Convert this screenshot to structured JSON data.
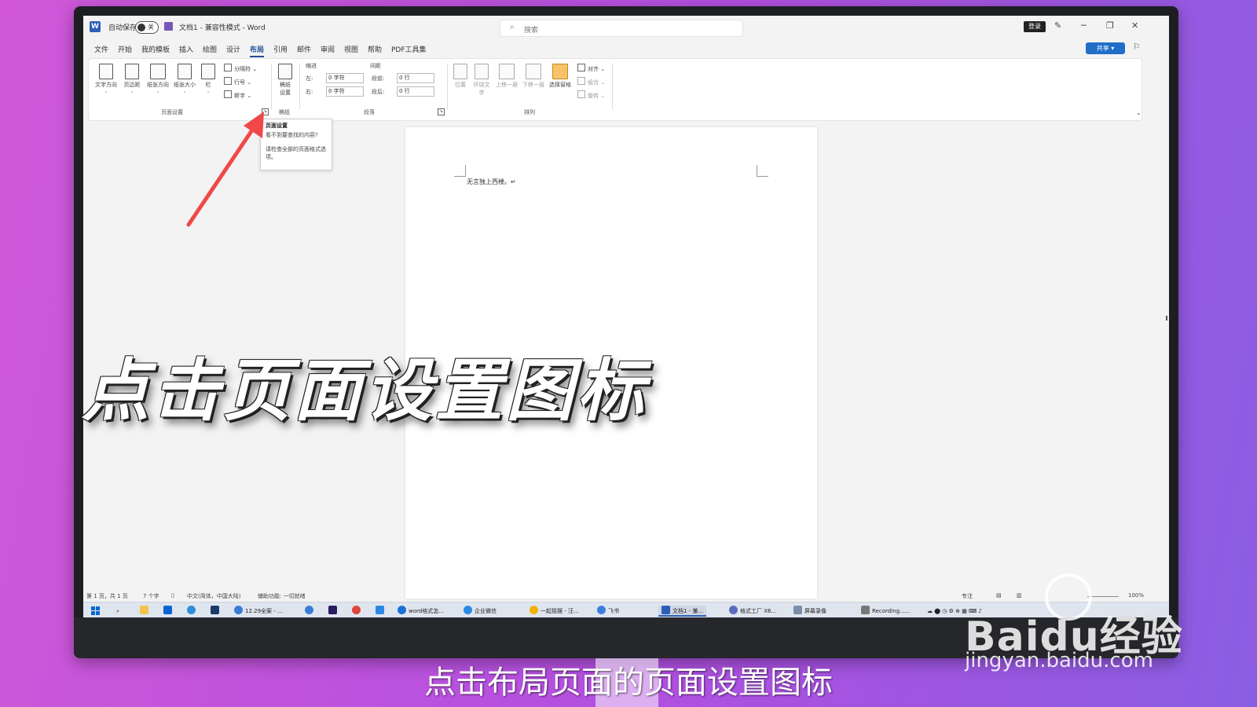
{
  "titlebar": {
    "autosave_label": "自动保存",
    "autosave_state": "关",
    "doc_title": "文档1 - 兼容性模式 - Word",
    "search_placeholder": "搜索",
    "login_label": "登录"
  },
  "menu": {
    "tabs": [
      "文件",
      "开始",
      "我的模板",
      "插入",
      "绘图",
      "设计",
      "布局",
      "引用",
      "邮件",
      "审阅",
      "视图",
      "帮助",
      "PDF工具集"
    ],
    "active_index": 6,
    "share_label": "共享"
  },
  "ribbon": {
    "page_setup": {
      "text_direction": "文字方向",
      "margins": "页边距",
      "orientation": "纸张方向",
      "size": "纸张大小",
      "columns": "栏",
      "breaks": "分隔符",
      "line_numbers": "行号",
      "hyphenation": "断字",
      "group_label": "页面设置"
    },
    "draft": {
      "button": "稿纸设置",
      "group_label": "稿纸"
    },
    "paragraph": {
      "indent_header": "缩进",
      "spacing_header": "间距",
      "left_label": "左:",
      "left_value": "0 字符",
      "right_label": "右:",
      "right_value": "0 字符",
      "before_label": "段前:",
      "before_value": "0 行",
      "after_label": "段后:",
      "after_value": "0 行",
      "group_label": "段落"
    },
    "arrange": {
      "position": "位置",
      "wrap_text": "环绕文字",
      "bring_forward": "上移一层",
      "send_backward": "下移一层",
      "selection_pane": "选择窗格",
      "align": "对齐",
      "group": "组合",
      "rotate": "旋转",
      "group_label": "排列"
    }
  },
  "tooltip": {
    "title": "页面设置",
    "question": "看不到要查找的内容?",
    "description": "请检查全部的页面格式选项。"
  },
  "document": {
    "text": "无言独上西楼。↵"
  },
  "statusbar": {
    "page": "第 1 页，共 1 页",
    "words": "7 个字",
    "language": "中文(简体，中国大陆)",
    "accessibility": "辅助功能: 一切就绪",
    "focus": "专注",
    "zoom": "100%"
  },
  "taskbar": {
    "items": [
      "12.29全案 - ...",
      "word格式怎...",
      "企业微信",
      "一起摇摆 - 汪...",
      "飞书",
      "文档1 - 兼...",
      "格式工厂 X6...",
      "屏幕录像",
      "Recording......"
    ],
    "active_index": 5,
    "icon_colors": [
      "#3a7bd5",
      "#1b6fd8",
      "#2b89e6",
      "#f0b400",
      "#3d7de0",
      "#2b5fb7",
      "#5a6bbf",
      "#7b8fa6",
      "#777777"
    ]
  },
  "caption": "点击页面设置图标",
  "subtitle": "点击布局页面的页面设置图标",
  "watermark": {
    "logo": "Baidu经验",
    "url": "jingyan.baidu.com"
  },
  "colors": {
    "accent": "#1f4e99",
    "arrow": "#f04848",
    "share": "#1f6ec7"
  }
}
